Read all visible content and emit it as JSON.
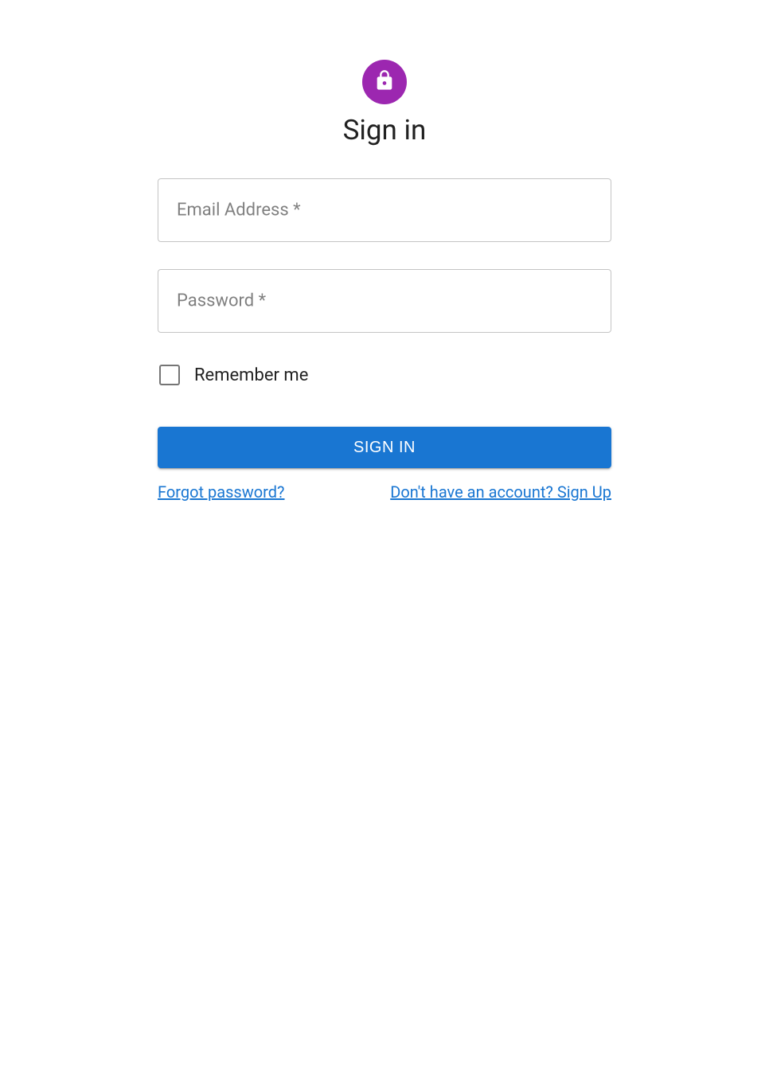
{
  "header": {
    "title": "Sign in",
    "icon": "lock-icon"
  },
  "form": {
    "email": {
      "label": "Email Address *",
      "value": ""
    },
    "password": {
      "label": "Password *",
      "value": ""
    },
    "remember": {
      "label": "Remember me",
      "checked": false
    },
    "submit_label": "Sign In"
  },
  "links": {
    "forgot_password": "Forgot password?",
    "signup": "Don't have an account? Sign Up"
  },
  "colors": {
    "avatar": "#9c27b0",
    "primary": "#1976d2"
  }
}
